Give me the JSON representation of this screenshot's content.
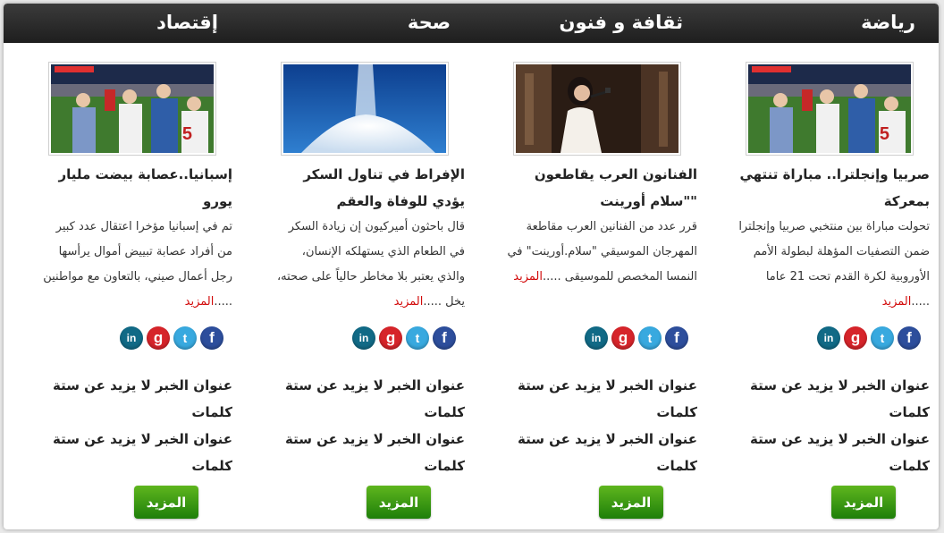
{
  "columns": [
    {
      "category": "رياضة",
      "image": "football-match-photo",
      "news_title": "صربيا وإنجلترا.. مباراة تنتهي بمعركة",
      "news_body": "تحولت مباراة بين منتخبي صربيا وإنجلترا ضمن التصفيات المؤهلة لبطولة الأمم الأوروبية لكرة القدم تحت 21 عاما .....",
      "more_link": "المزيد",
      "headlines": [
        "عنوان الخبر لا يزيد عن ستة كلمات",
        "عنوان الخبر لا يزيد عن ستة كلمات"
      ],
      "more_button": "المزيد"
    },
    {
      "category": "ثقافة و فنون",
      "image": "singer-on-stage-photo",
      "news_title": "الفنانون العرب يقاطعون \"\"سلام أورينت",
      "news_body": "قرر عدد من الفنانين العرب مقاطعة المهرجان الموسيقي \"سلام.أورينت\" في النمسا المخصص للموسيقى .....",
      "more_link": "المزيد",
      "headlines": [
        "عنوان الخبر لا يزيد عن ستة كلمات",
        "عنوان الخبر لا يزيد عن ستة كلمات"
      ],
      "more_button": "المزيد"
    },
    {
      "category": "صحة",
      "image": "sugar-pile-photo",
      "news_title": "الإفراط في تناول السكر يؤدي للوفاة والعقم",
      "news_body": "قال باحثون أميركيون إن زيادة السكر في الطعام الذي يستهلكه الإنسان، والذي يعتبر بلا مخاطر حالياً على صحته، يخل .....",
      "more_link": "المزيد",
      "headlines": [
        "عنوان الخبر لا يزيد عن ستة كلمات",
        "عنوان الخبر لا يزيد عن ستة كلمات"
      ],
      "more_button": "المزيد"
    },
    {
      "category": "إقتصاد",
      "image": "football-match-photo",
      "news_title": "إسبانيا..عصابة بيضت مليار يورو",
      "news_body": "تم في إسبانيا مؤخرا اعتقال عدد كبير من أفراد عصابة تبييض أموال يرأسها رجل أعمال صيني، بالتعاون مع مواطنين .....",
      "more_link": "المزيد",
      "headlines": [
        "عنوان الخبر لا يزيد عن ستة كلمات",
        "عنوان الخبر لا يزيد عن ستة كلمات"
      ],
      "more_button": "المزيد"
    }
  ],
  "social": {
    "facebook": "f",
    "twitter": "t",
    "google": "g",
    "linkedin": "in"
  },
  "colors": {
    "header_bg": "#2a2a2a",
    "link_red": "#d20a0a",
    "button_green": "#3a9a14",
    "facebook": "#2d4e9c",
    "twitter": "#38a9df",
    "google": "#d6242a",
    "linkedin": "#116a86"
  }
}
